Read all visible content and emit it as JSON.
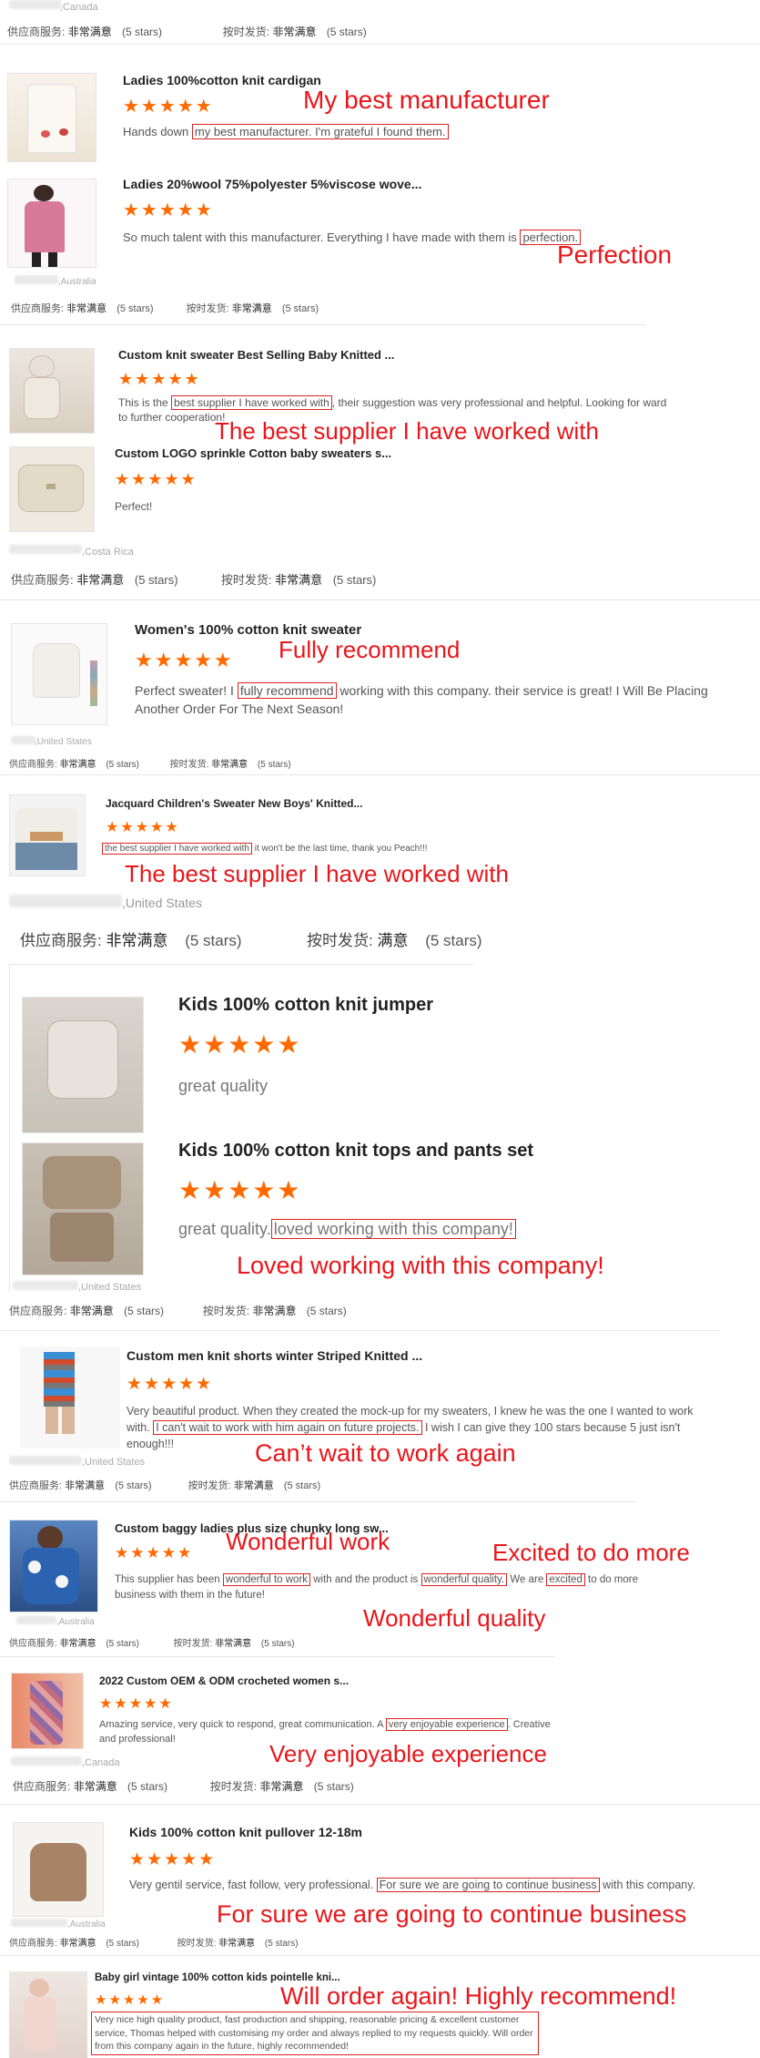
{
  "labels": {
    "service": "供应商服务:",
    "delivery": "按时发货:"
  },
  "reviews": [
    {
      "country": ",Canada",
      "service_val": "非常满意",
      "service_stars": "(5 stars)",
      "delivery_val": "非常满意",
      "delivery_stars": "(5 stars)"
    },
    {
      "items": [
        {
          "title": "Ladies 100%cotton knit cardigan",
          "stars": "★★★★★",
          "pre": "Hands down ",
          "highlight": "my best manufacturer. I'm grateful I found them.",
          "post": ""
        },
        {
          "title": "Ladies 20%wool 75%polyester 5%viscose wove...",
          "stars": "★★★★★",
          "pre": "So much talent with this manufacturer. Everything I have made with them is ",
          "highlight": "perfection.",
          "post": ""
        }
      ],
      "annotations": [
        "My best manufacturer",
        "Perfection"
      ],
      "country": ",Australia",
      "service_val": "非常满意",
      "service_stars": "(5 stars)",
      "delivery_val": "非常满意",
      "delivery_stars": "(5 stars)"
    },
    {
      "items": [
        {
          "title": "Custom knit sweater Best Selling Baby Knitted ...",
          "stars": "★★★★★",
          "pre": "This is the ",
          "highlight": "best supplier I have worked with",
          "post": ", their suggestion was very professional and helpful. Looking for ward to further cooperation!"
        },
        {
          "title": "Custom LOGO sprinkle Cotton baby sweaters s...",
          "stars": "★★★★★",
          "pre": "Perfect!",
          "highlight": "",
          "post": ""
        }
      ],
      "annotations": [
        "The best supplier I have worked with"
      ],
      "country": ",Costa Rica",
      "service_val": "非常满意",
      "service_stars": "(5 stars)",
      "delivery_val": "非常满意",
      "delivery_stars": "(5 stars)"
    },
    {
      "items": [
        {
          "title": "Women's 100% cotton knit sweater",
          "stars": "★★★★★",
          "pre": "Perfect sweater! I ",
          "highlight": "fully recommend",
          "post": " working with this company. their service is great! I Will Be Placing Another Order For The Next Season!"
        }
      ],
      "annotations": [
        "Fully recommend"
      ],
      "country": ",United States",
      "service_val": "非常满意",
      "service_stars": "(5 stars)",
      "delivery_val": "非常满意",
      "delivery_stars": "(5 stars)"
    },
    {
      "items": [
        {
          "title": "Jacquard Children's Sweater New Boys' Knitted...",
          "stars": "★★★★★",
          "pre": "",
          "highlight": "the best supplier I have worked with",
          "post": " it won't be the last time, thank you Peach!!!"
        }
      ],
      "annotations": [
        "The best supplier I have worked with"
      ],
      "country": ",United States",
      "service_val": "非常满意",
      "service_stars": "(5 stars)",
      "delivery_val": "满意",
      "delivery_stars": "(5 stars)"
    },
    {
      "items": [
        {
          "title": "Kids 100% cotton knit jumper",
          "stars": "★★★★★",
          "pre": "great quality",
          "highlight": "",
          "post": ""
        },
        {
          "title": "Kids 100% cotton knit tops and pants set",
          "stars": "★★★★★",
          "pre": "great quality.",
          "highlight": "loved working with this company!",
          "post": ""
        }
      ],
      "annotations": [
        "Loved working with this company!"
      ],
      "country": ",United States",
      "service_val": "非常满意",
      "service_stars": "(5 stars)",
      "delivery_val": "非常满意",
      "delivery_stars": "(5 stars)"
    },
    {
      "items": [
        {
          "title": "Custom men knit shorts winter Striped Knitted ...",
          "stars": "★★★★★",
          "pre": "Very beautiful product. When they created the mock-up for my sweaters, I knew he was the one I wanted to work with. ",
          "highlight": "I can't wait to work with him again on future projects.",
          "post": " I wish I can give they 100 stars because 5 just isn't enough!!!"
        }
      ],
      "annotations": [
        "Can’t wait to work again"
      ],
      "country": ",United States",
      "service_val": "非常满意",
      "service_stars": "(5 stars)",
      "delivery_val": "非常满意",
      "delivery_stars": "(5 stars)"
    },
    {
      "items": [
        {
          "title": "Custom baggy ladies plus size chunky long sw...",
          "stars": "★★★★★",
          "pre": "This supplier has been ",
          "highlight": "wonderful to work",
          "post": " with and the product is ",
          "highlight2": "wonderful quality.",
          "post2": " We are ",
          "highlight3": "excited",
          "post3": " to do more business with them in the future!"
        }
      ],
      "annotations": [
        "Wonderful work",
        "Excited to do more",
        "Wonderful quality"
      ],
      "country": ",Australia",
      "service_val": "非常满意",
      "service_stars": "(5 stars)",
      "delivery_val": "非常满意",
      "delivery_stars": "(5 stars)"
    },
    {
      "items": [
        {
          "title": "2022 Custom OEM & ODM crocheted women s...",
          "stars": "★★★★★",
          "pre": "Amazing service, very quick to respond, great communication. A ",
          "highlight": "very enjoyable experience",
          "post": ". Creative and professional!"
        }
      ],
      "annotations": [
        "Very enjoyable experience"
      ],
      "country": ",Canada",
      "service_val": "非常满意",
      "service_stars": "(5 stars)",
      "delivery_val": "非常满意",
      "delivery_stars": "(5 stars)"
    },
    {
      "items": [
        {
          "title": "Kids 100% cotton knit pullover 12-18m",
          "stars": "★★★★★",
          "pre": "Very gentil service, fast follow, very professional. ",
          "highlight": "For sure we are going to continue business",
          "post": " with this company."
        }
      ],
      "annotations": [
        "For sure we are going to continue business"
      ],
      "country": ",Australia",
      "service_val": "非常满意",
      "service_stars": "(5 stars)",
      "delivery_val": "非常满意",
      "delivery_stars": "(5 stars)"
    },
    {
      "items": [
        {
          "title": "Baby girl vintage 100% cotton kids pointelle kni...",
          "stars": "★★★★★",
          "pre": "",
          "highlight": "Very nice high quality product, fast production and shipping, reasonable pricing & excellent customer service, Thomas helped with customising my order and always replied to my requests quickly. Will order from this company again in the future, highly recommended!",
          "post": ""
        }
      ],
      "annotations": [
        "Will order again! Highly recommend!"
      ]
    }
  ]
}
